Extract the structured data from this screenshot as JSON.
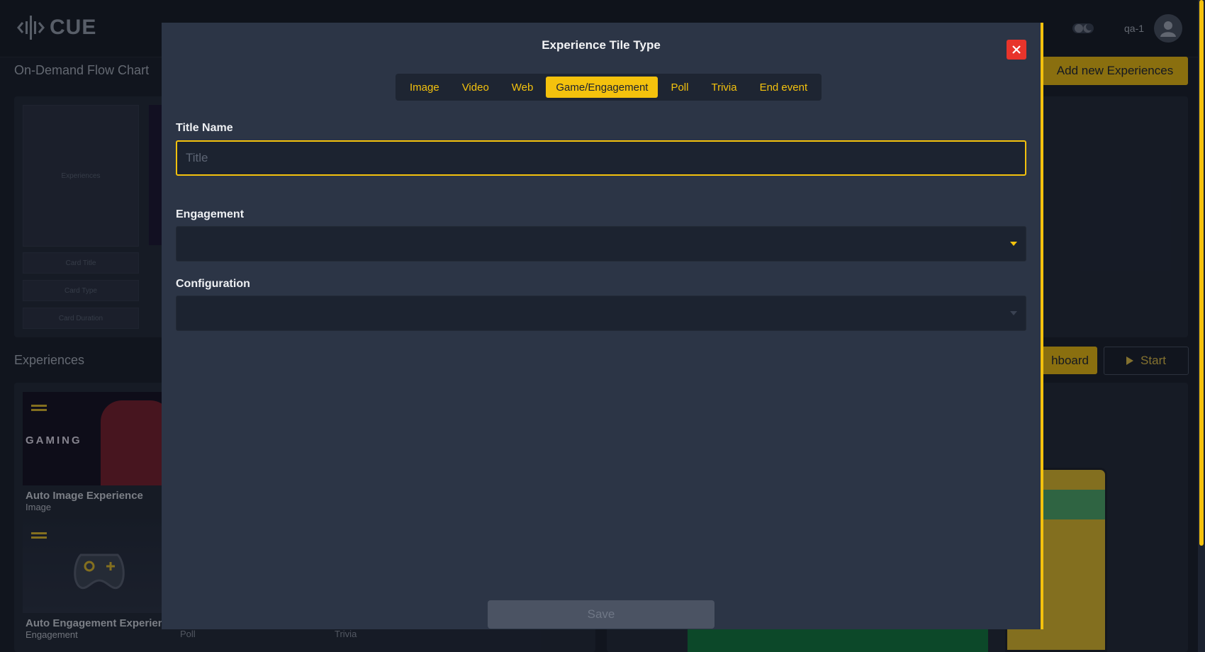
{
  "app": {
    "logo_text": "CUE",
    "user_label": "qa-1"
  },
  "flow_chart": {
    "title": "On-Demand Flow Chart",
    "placeholder_experiences": "Experiences",
    "placeholder_card_title": "Card Title",
    "placeholder_card_type": "Card Type",
    "placeholder_card_duration": "Card Duration",
    "add_button": "Add new Experiences"
  },
  "experiences": {
    "title": "Experiences",
    "dashboard_button_partial": "hboard",
    "start_button": "Start",
    "cards": [
      {
        "title": "Auto Image Experience",
        "type": "Image",
        "thumb_text": "GAMING"
      },
      {
        "title": "Auto Engagement Experienc",
        "type": "Engagement"
      }
    ],
    "row_types": [
      "Poll",
      "Trivia"
    ]
  },
  "modal": {
    "title": "Experience Tile Type",
    "tabs": [
      {
        "label": "Image",
        "active": false
      },
      {
        "label": "Video",
        "active": false
      },
      {
        "label": "Web",
        "active": false
      },
      {
        "label": "Game/Engagement",
        "active": true
      },
      {
        "label": "Poll",
        "active": false
      },
      {
        "label": "Trivia",
        "active": false
      },
      {
        "label": "End event",
        "active": false
      }
    ],
    "title_field": {
      "label": "Title Name",
      "value": "",
      "placeholder": "Title"
    },
    "engagement_field": {
      "label": "Engagement",
      "value": ""
    },
    "configuration_field": {
      "label": "Configuration",
      "value": ""
    },
    "save_label": "Save"
  },
  "colors": {
    "accent": "#f4c20d",
    "modal_bg": "#2c3546",
    "page_bg": "#181e28",
    "close": "#e8342b"
  }
}
